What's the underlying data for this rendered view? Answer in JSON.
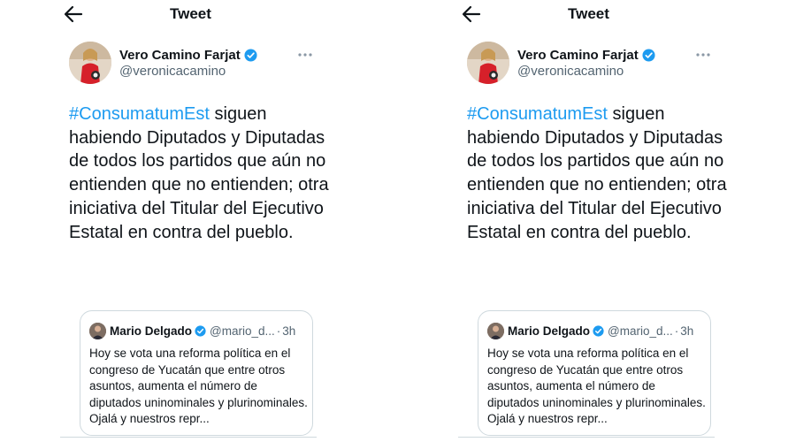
{
  "header": {
    "title": "Tweet",
    "back_icon": "arrow-left-icon"
  },
  "tweet": {
    "display_name": "Vero Camino Farjat",
    "handle": "@veronicacamino",
    "verified": true,
    "hashtag": "#ConsumatumEst",
    "body": " siguen habiendo Diputados y Diputadas de todos los partidos que aún no entienden que no entienden; otra iniciativa del Titular del Ejecutivo Estatal en contra del pueblo."
  },
  "quoted_tweet": {
    "display_name": "Mario Delgado",
    "handle": "@mario_d...",
    "separator": "·",
    "time": "3h",
    "verified": true,
    "text": "Hoy se vota una reforma política en el congreso de Yucatán que entre otros asuntos, aumenta el número de diputados uninominales y plurinominales. Ojalá y nuestros repr..."
  },
  "colors": {
    "accent": "#1d9bf0",
    "text": "#0f1419",
    "secondary": "#536471",
    "border": "#cfd9de"
  }
}
